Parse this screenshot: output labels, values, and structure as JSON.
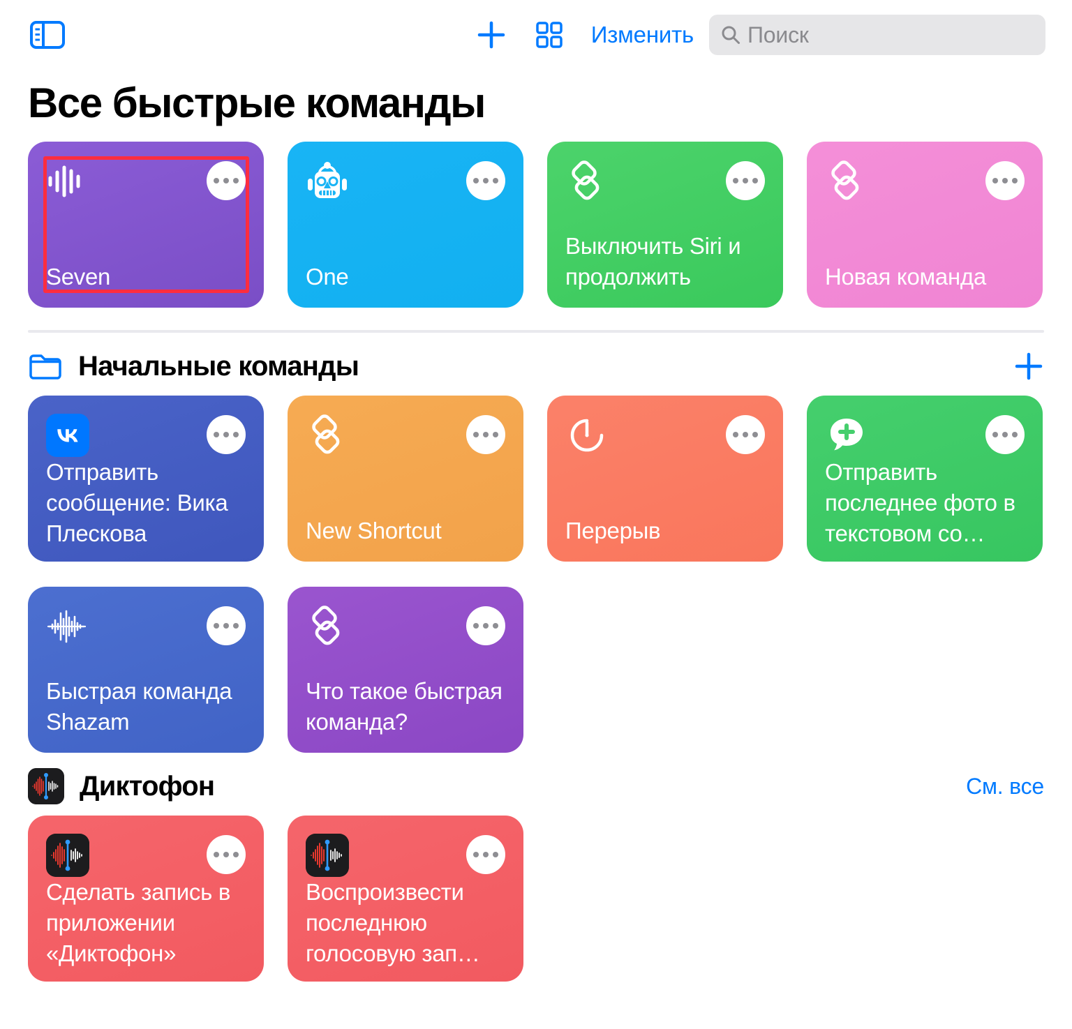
{
  "toolbar": {
    "sidebar_toggle_name": "sidebar-toggle-icon",
    "add_label": "+",
    "grid_view_label": "grid-view",
    "edit_label": "Изменить",
    "search_placeholder": "Поиск"
  },
  "page": {
    "title": "Все быстрые команды"
  },
  "sections": [
    {
      "id": "all",
      "cards": [
        {
          "title": "Seven",
          "color": "#8b5cd6",
          "color2": "#7a4ec6",
          "icon": "waveform-bars-icon",
          "selected": true
        },
        {
          "title": "One",
          "color": "#19b4f5",
          "color2": "#12b0f0",
          "icon": "robot-icon",
          "selected": false
        },
        {
          "title": "Выключить Siri и продолжить",
          "color": "#4cd36b",
          "color2": "#3ac95c",
          "icon": "shortcuts-layers-icon",
          "selected": false
        },
        {
          "title": "Новая команда",
          "color": "#f48fd8",
          "color2": "#f084d3",
          "icon": "shortcuts-layers-icon",
          "selected": false
        }
      ]
    },
    {
      "id": "starter",
      "header": {
        "title": "Начальные команды",
        "icon": "folder-icon",
        "action": "add-to-folder-button"
      },
      "cards": [
        {
          "title": "Отправить сообщение: Вика Плескова",
          "color": "#4a63c8",
          "color2": "#3f57bd",
          "icon": "vk-icon",
          "selected": false
        },
        {
          "title": "New Shortcut",
          "color": "#f6ab53",
          "color2": "#f2a24a",
          "icon": "shortcuts-layers-icon",
          "selected": false
        },
        {
          "title": "Перерыв",
          "color": "#fb8169",
          "color2": "#f9765c",
          "icon": "timer-icon",
          "selected": false
        },
        {
          "title": "Отправить последнее фото в текстовом со…",
          "color": "#45cf6d",
          "color2": "#37c660",
          "icon": "message-plus-icon",
          "selected": false
        },
        {
          "title": "Быстрая команда Shazam",
          "color": "#4c6fd0",
          "color2": "#4163c6",
          "icon": "shazam-waveform-icon",
          "selected": false
        },
        {
          "title": "Что такое быстрая команда?",
          "color": "#9a55cf",
          "color2": "#8b47c4",
          "icon": "shortcuts-layers-icon",
          "selected": false
        }
      ]
    },
    {
      "id": "voice-memos",
      "header": {
        "title": "Диктофон",
        "icon": "voice-memos-app-icon",
        "link": "См. все"
      },
      "cards": [
        {
          "title": "Сделать запись в приложении «Диктофон»",
          "color": "#f5656b",
          "color2": "#f25a60",
          "icon": "voice-memos-app-icon",
          "selected": false
        },
        {
          "title": "Воспроизвести последнюю голосовую зап…",
          "color": "#f5656b",
          "color2": "#f25a60",
          "icon": "voice-memos-app-icon",
          "selected": false
        }
      ]
    }
  ],
  "colors": {
    "accent": "#007aff",
    "selection": "#ff2d3f",
    "search_bg": "#e6e6e8",
    "divider": "#e9e9ee"
  }
}
